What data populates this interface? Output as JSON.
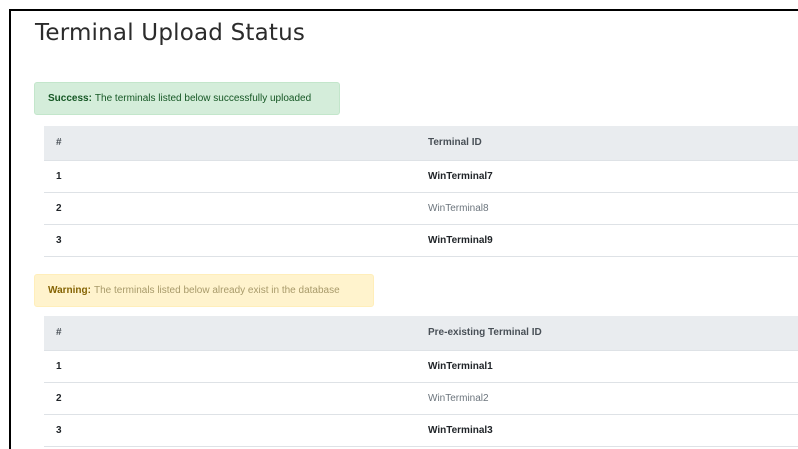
{
  "page": {
    "title": "Terminal Upload Status"
  },
  "success_alert": {
    "label": "Success:",
    "message": "The terminals listed below successfully uploaded"
  },
  "uploaded_table": {
    "headers": [
      "#",
      "Terminal ID"
    ],
    "rows": [
      {
        "num": "1",
        "terminal_id": "WinTerminal7"
      },
      {
        "num": "2",
        "terminal_id": "WinTerminal8"
      },
      {
        "num": "3",
        "terminal_id": "WinTerminal9"
      }
    ]
  },
  "warning_alert": {
    "label": "Warning:",
    "message": "The terminals listed below already exist in the database"
  },
  "existing_table": {
    "headers": [
      "#",
      "Pre-existing Terminal ID"
    ],
    "rows": [
      {
        "num": "1",
        "terminal_id": "WinTerminal1"
      },
      {
        "num": "2",
        "terminal_id": "WinTerminal2"
      },
      {
        "num": "3",
        "terminal_id": "WinTerminal3"
      }
    ]
  },
  "colors": {
    "success_bg": "#d4edda",
    "success_text": "#155724",
    "warning_bg": "#fff3cd",
    "warning_text": "#856404",
    "table_header_bg": "#e9ecef"
  }
}
